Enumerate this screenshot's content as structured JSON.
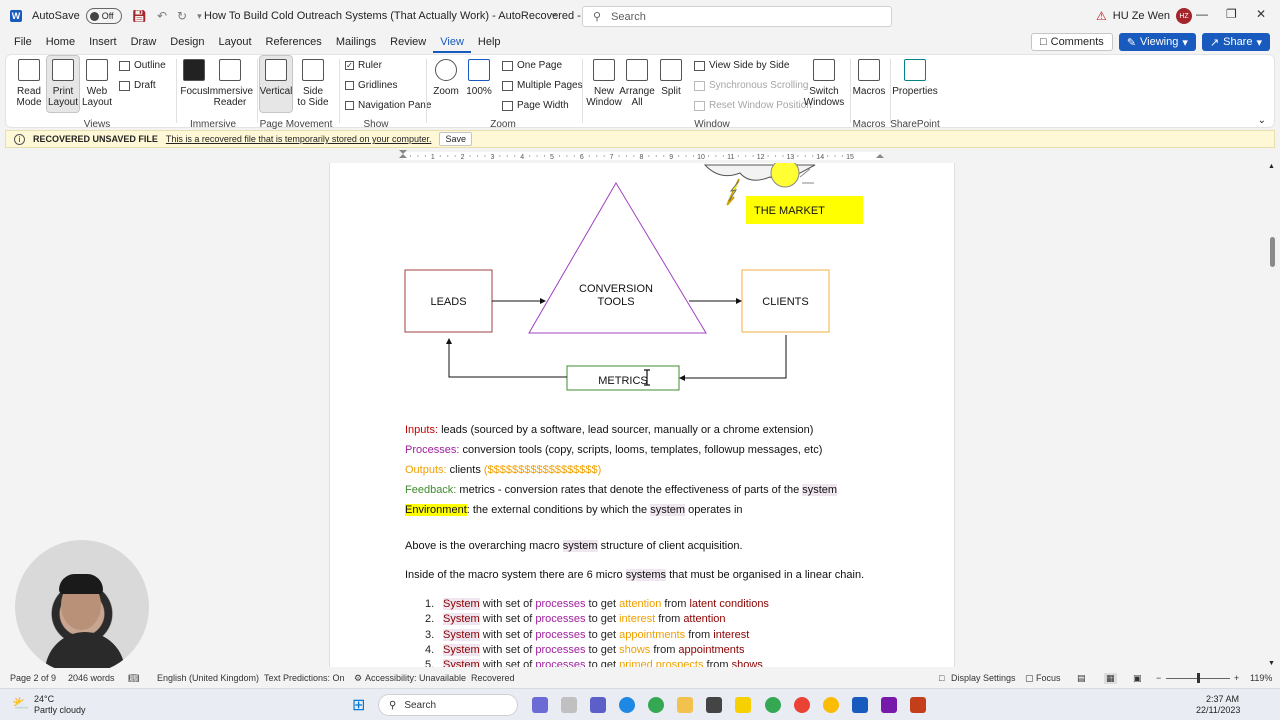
{
  "titlebar": {
    "autosave_label": "AutoSave",
    "autosave_state": "Off",
    "doc_title": "How To Build Cold Outreach Systems (That Actually Work) - AutoRecovered - Compatibility...",
    "search_placeholder": "Search",
    "user_name": "HU Ze Wen",
    "user_initials": "HZ"
  },
  "menu": {
    "tabs": [
      "File",
      "Home",
      "Insert",
      "Draw",
      "Design",
      "Layout",
      "References",
      "Mailings",
      "Review",
      "View",
      "Help"
    ],
    "active": "View",
    "comments": "Comments",
    "viewing": "Viewing",
    "share": "Share"
  },
  "ribbon": {
    "read_mode": [
      "Read",
      "Mode"
    ],
    "print_layout": [
      "Print",
      "Layout"
    ],
    "web_layout": [
      "Web",
      "Layout"
    ],
    "outline": "Outline",
    "draft": "Draft",
    "views_group": "Views",
    "focus": "Focus",
    "immersive_reader": [
      "Immersive",
      "Reader"
    ],
    "immersive_group": "Immersive",
    "vertical": "Vertical",
    "side_to_side": [
      "Side",
      "to Side"
    ],
    "page_movement_group": "Page Movement",
    "ruler": "Ruler",
    "gridlines": "Gridlines",
    "navigation_pane": "Navigation Pane",
    "show_group": "Show",
    "zoom": "Zoom",
    "zoom_100": "100%",
    "one_page": "One Page",
    "multiple_pages": "Multiple Pages",
    "page_width": "Page Width",
    "zoom_group": "Zoom",
    "new_window": [
      "New",
      "Window"
    ],
    "arrange_all": [
      "Arrange",
      "All"
    ],
    "split": "Split",
    "view_side_by_side": "View Side by Side",
    "sync_scrolling": "Synchronous Scrolling",
    "reset_window": "Reset Window Position",
    "switch_windows": [
      "Switch",
      "Windows"
    ],
    "window_group": "Window",
    "macros": "Macros",
    "macros_group": "Macros",
    "properties": "Properties",
    "sharepoint_group": "SharePoint"
  },
  "infobar": {
    "title": "RECOVERED UNSAVED FILE",
    "message": "This is a recovered file that is temporarily stored on your computer.",
    "save": "Save"
  },
  "ruler": {
    "ticks": [
      "1",
      "2",
      "3",
      "4",
      "5",
      "6",
      "7",
      "8",
      "9",
      "10",
      "11",
      "12",
      "13",
      "14",
      "15"
    ]
  },
  "diagram": {
    "market": "THE MARKET",
    "leads": "LEADS",
    "conversion_1": "CONVERSION",
    "conversion_2": "TOOLS",
    "clients": "CLIENTS",
    "metrics": "METRICS"
  },
  "doc": {
    "inputs_label": "Inputs:",
    "inputs_text": " leads (sourced by a software, lead sourcer, manually or a chrome extension)",
    "processes_label": "Processes:",
    "processes_text": " conversion tools (copy, scripts, looms, templates, followup messages, etc)",
    "outputs_label": "Outputs:",
    "outputs_text": " clients ",
    "outputs_dollars": "($$$$$$$$$$$$$$$$$$)",
    "feedback_label": "Feedback:",
    "feedback_text": " metrics - conversion rates that denote the effectiveness of parts of the ",
    "feedback_system": "system",
    "environment_label": "Environment",
    "environment_text_1": ": the external conditions by which the ",
    "environment_system": "system",
    "environment_text_2": " operates in",
    "macro_1": "Above is the overarching macro ",
    "macro_system": "system",
    "macro_2": " structure of client acquisition.",
    "micro_1": "Inside of the macro system there are 6 micro ",
    "micro_systems": "systems",
    "micro_2": " that must be organised in a linear chain.",
    "list": [
      {
        "num": "1.",
        "system": "System",
        "mid1": " with set of ",
        "proc": "processes",
        "mid2": " to get ",
        "target": "attention",
        "mid3": " from ",
        "source": "latent conditions"
      },
      {
        "num": "2.",
        "system": "System",
        "mid1": " with set of ",
        "proc": "processes",
        "mid2": " to get ",
        "target": "interest",
        "mid3": " from ",
        "source": "attention"
      },
      {
        "num": "3.",
        "system": "System",
        "mid1": " with set of ",
        "proc": "processes",
        "mid2": " to get ",
        "target": "appointments",
        "mid3": " from ",
        "source": "interest"
      },
      {
        "num": "4.",
        "system": "System",
        "mid1": " with set of ",
        "proc": "processes",
        "mid2": " to get ",
        "target": "shows",
        "mid3": " from ",
        "source": "appointments"
      },
      {
        "num": "5.",
        "system": "System",
        "mid1": " with set of ",
        "proc": "processes",
        "mid2": " to get ",
        "target": "primed prospects",
        "mid3": " from ",
        "source": "shows"
      }
    ]
  },
  "status": {
    "page": "Page 2 of 9",
    "words": "2046 words",
    "language": "English (United Kingdom)",
    "text_predictions": "Text Predictions: On",
    "accessibility": "Accessibility: Unavailable",
    "recovered": "Recovered",
    "display_settings": "Display Settings",
    "focus": "Focus",
    "zoom": "119%"
  },
  "taskbar": {
    "temp": "24°C",
    "weather": "Partly cloudy",
    "search": "Search",
    "time": "2:37 AM",
    "date": "22/11/2023"
  },
  "colors": {
    "accent": "#185abd",
    "highlight": "#ffff00",
    "inputs": "#c00000",
    "processes": "#a020a0",
    "outputs": "#f0a000",
    "feedback": "#3c8c2c"
  }
}
